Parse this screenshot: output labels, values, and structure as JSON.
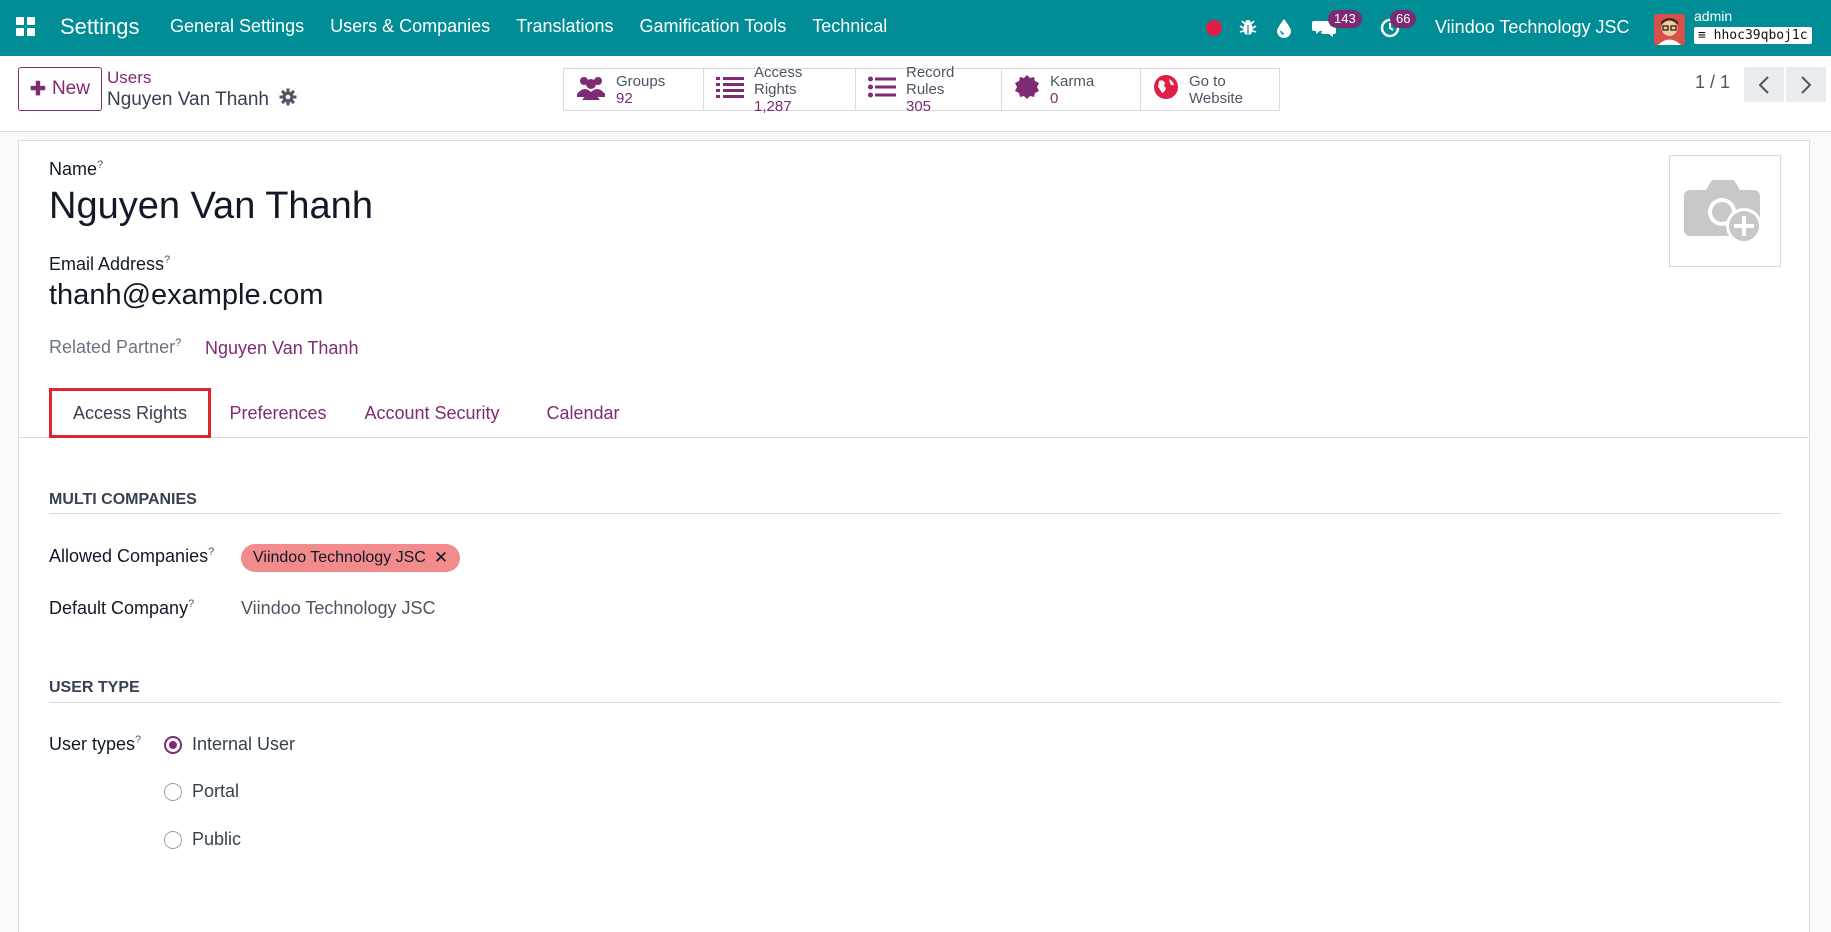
{
  "navbar": {
    "app_name": "Settings",
    "menu": [
      "General Settings",
      "Users & Companies",
      "Translations",
      "Gamification Tools",
      "Technical"
    ],
    "messages_count": "143",
    "activities_count": "66",
    "company": "Viindoo Technology JSC",
    "user": "admin",
    "database": "hhoc39qboj1c"
  },
  "control": {
    "new_label": "New",
    "breadcrumb_parent": "Users",
    "breadcrumb_current": "Nguyen Van Thanh",
    "stats": {
      "groups_label": "Groups",
      "groups_value": "92",
      "access_label": "Access Rights",
      "access_value": "1,287",
      "rules_label": "Record Rules",
      "rules_value": "305",
      "karma_label": "Karma",
      "karma_value": "0",
      "website_line1": "Go to",
      "website_line2": "Website"
    },
    "pager": "1 / 1"
  },
  "form": {
    "name_label": "Name",
    "name_value": "Nguyen Van Thanh",
    "email_label": "Email Address",
    "email_value": "thanh@example.com",
    "partner_label": "Related Partner",
    "partner_value": "Nguyen Van Thanh",
    "help_mark": "?"
  },
  "tabs": [
    "Access Rights",
    "Preferences",
    "Account Security",
    "Calendar"
  ],
  "multi_companies": {
    "title": "MULTI COMPANIES",
    "allowed_label": "Allowed Companies",
    "allowed_tag": "Viindoo Technology JSC",
    "default_label": "Default Company",
    "default_value": "Viindoo Technology JSC"
  },
  "user_type": {
    "title": "USER TYPE",
    "label": "User types",
    "options": [
      "Internal User",
      "Portal",
      "Public"
    ],
    "selected": "Internal User"
  },
  "colors": {
    "navbar": "#018d96",
    "primary": "#7f2a75",
    "highlight_border": "#e0242b",
    "tag_bg": "#f28b8b"
  }
}
